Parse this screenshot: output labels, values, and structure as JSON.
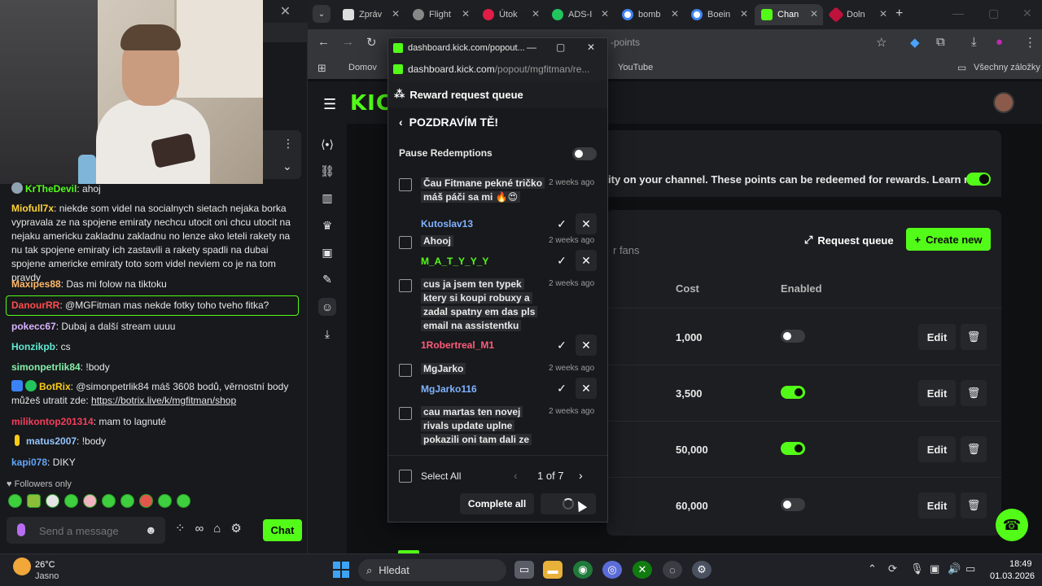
{
  "chat": {
    "top_close": "✕",
    "messages": [
      {
        "user": "KrTheDevil",
        "text": "ahoj",
        "color": "#53fc18"
      },
      {
        "user": "Miofull7x",
        "text": "niekde som videl na socialnych sietach nejaka borka vypravala ze na spojene emiraty nechcu utocit oni chcu utocit na nejaku americku zakladnu zakladnu no lenze ako leteli rakety na nu tak spojene emiraty ich zastavili a rakety spadli na dubai spojene americke emiraty toto som videl neviem co je na tom pravdy",
        "color": "#ffd43b"
      },
      {
        "user": "Maxipes88",
        "text": "Das mi folow na tiktoku",
        "color": "#ffb86b"
      },
      {
        "user": "DanourRR",
        "text": "@MGFitman mas nekde fotky toho tveho fitka?",
        "color": "#ff4d4d"
      },
      {
        "user": "pokecc67",
        "text": "Dubaj a další stream uuuu",
        "color": "#d8b4fe"
      },
      {
        "user": "Honzikpb",
        "text": "cs",
        "color": "#5eead4"
      },
      {
        "user": "simonpetrlik84",
        "text": "!body",
        "color": "#86efac"
      },
      {
        "user": "BotRix",
        "text": "@simonpetrlik84 máš 3608 bodů, věrnostní body můžeš utratit zde: ",
        "link": "https://botrix.live/k/mgfitman/shop",
        "color": "#facc15"
      },
      {
        "user": "milikontop201314",
        "text": "mam to lagnuté",
        "color": "#f43f5e"
      },
      {
        "user": "matus2007",
        "text": "!body",
        "color": "#93c5fd"
      },
      {
        "user": "kapi078",
        "text": "DIKY",
        "color": "#60a5fa"
      }
    ],
    "followers_only": "Followers only",
    "input_placeholder": "Send a message",
    "send_label": "Chat"
  },
  "browser": {
    "tabs": [
      {
        "label": "Zpráv",
        "color": "#c8c8c8"
      },
      {
        "label": "Flight",
        "color": "#c8c8c8"
      },
      {
        "label": "Útok",
        "color": "#e11d48"
      },
      {
        "label": "ADS-I",
        "color": "#22c55e"
      },
      {
        "label": "bomb",
        "color": "#4285f4"
      },
      {
        "label": "Boein",
        "color": "#4285f4"
      },
      {
        "label": "Chan",
        "color": "#53fc18"
      },
      {
        "label": "Doln",
        "color": "#be123c"
      }
    ],
    "address_fragment": "-points",
    "bookmarks": {
      "first": "Domov",
      "youtube": "YouTube",
      "all": "Všechny záložky"
    }
  },
  "dashboard": {
    "logo": "KICK",
    "info_text": "ity on your channel. These points can be redeemed for rewards. Learn more",
    "fans_text": "r fans",
    "request_queue": "Request queue",
    "create_new": "Create new",
    "headers": {
      "cost": "Cost",
      "enabled": "Enabled"
    },
    "rows": [
      {
        "cost": "1,000",
        "enabled": false
      },
      {
        "cost": "3,500",
        "enabled": true
      },
      {
        "cost": "50,000",
        "enabled": true
      },
      {
        "cost": "60,000",
        "enabled": false
      }
    ],
    "edit_label": "Edit"
  },
  "popout": {
    "window_title": "dashboard.kick.com/popout...",
    "url_host": "dashboard.kick.com",
    "url_path": "/popout/mgfitman/re...",
    "header": "Reward request queue",
    "reward_name": "POZDRAVÍM TĚ!",
    "pause_label": "Pause Redemptions",
    "requests": [
      {
        "message": "Čau Fitmane pekné tričko máš páči sa mi 🔥😍",
        "time": "2 weeks ago",
        "user": "Kutoslav13",
        "user_color": "#7fb3ff"
      },
      {
        "message": "Ahooj",
        "time": "2 weeks ago",
        "user": "M_A_T_Y_Y_Y",
        "user_color": "#53fc18"
      },
      {
        "message": "cus ja jsem ten typek ktery si koupi robuxy a zadal spatny em das pls email na assistentku",
        "time": "2 weeks ago",
        "user": "1Robertreal_M1",
        "user_color": "#ff5c7a"
      },
      {
        "message": "MgJarko",
        "time": "2 weeks ago",
        "user": "MgJarko116",
        "user_color": "#7fb3ff"
      },
      {
        "message": "cau martas ten novej rivals update uplne pokazili oni tam dali ze",
        "time": "2 weeks ago",
        "user": "",
        "user_color": "#7fb3ff"
      }
    ],
    "select_all": "Select All",
    "page": "1 of 7",
    "complete_all": "Complete all"
  },
  "taskbar": {
    "temp": "26°C",
    "weather": "Jasno",
    "search": "Hledat",
    "time": "18:49",
    "date": "01.03.2026"
  }
}
